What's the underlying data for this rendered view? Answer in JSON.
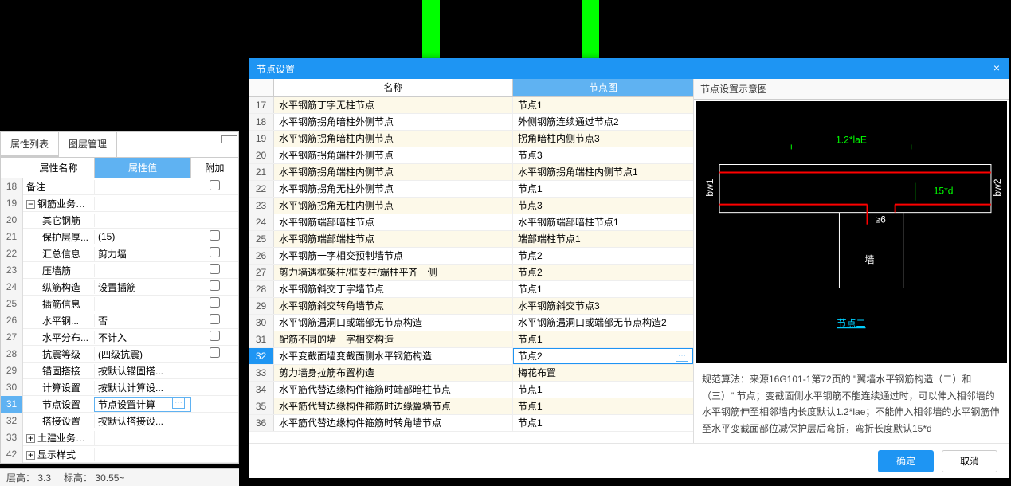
{
  "left": {
    "tab_props": "属性列表",
    "tab_layers": "图层管理",
    "hdr_name": "属性名称",
    "hdr_val": "属性值",
    "hdr_extra": "附加",
    "rows": [
      {
        "n": "18",
        "name": "备注",
        "val": "",
        "chk": true
      },
      {
        "n": "19",
        "name": "钢筋业务属性",
        "val": "",
        "group": true,
        "exp": "−"
      },
      {
        "n": "20",
        "name": "其它钢筋",
        "val": "",
        "indent": 2
      },
      {
        "n": "21",
        "name": "保护层厚...",
        "val": "(15)",
        "chk": true,
        "indent": 2
      },
      {
        "n": "22",
        "name": "汇总信息",
        "val": "剪力墙",
        "chk": true,
        "indent": 2
      },
      {
        "n": "23",
        "name": "压墙筋",
        "val": "",
        "chk": true,
        "indent": 2
      },
      {
        "n": "24",
        "name": "纵筋构造",
        "val": "设置插筋",
        "chk": true,
        "indent": 2
      },
      {
        "n": "25",
        "name": "插筋信息",
        "val": "",
        "chk": true,
        "indent": 2
      },
      {
        "n": "26",
        "name": "水平钢...",
        "val": "否",
        "chk": true,
        "indent": 2
      },
      {
        "n": "27",
        "name": "水平分布...",
        "val": "不计入",
        "chk": true,
        "indent": 2
      },
      {
        "n": "28",
        "name": "抗震等级",
        "val": "(四级抗震)",
        "chk": true,
        "indent": 2
      },
      {
        "n": "29",
        "name": "锚固搭接",
        "val": "按默认锚固搭...",
        "indent": 2
      },
      {
        "n": "30",
        "name": "计算设置",
        "val": "按默认计算设...",
        "indent": 2
      },
      {
        "n": "31",
        "name": "节点设置",
        "val": "节点设置计算",
        "indent": 2,
        "sel": true,
        "more": true
      },
      {
        "n": "32",
        "name": "搭接设置",
        "val": "按默认搭接设...",
        "indent": 2
      },
      {
        "n": "33",
        "name": "土建业务属性",
        "val": "",
        "group": true,
        "exp": "+"
      },
      {
        "n": "42",
        "name": "显示样式",
        "val": "",
        "group": true,
        "exp": "+"
      }
    ]
  },
  "status": {
    "floor_h_label": "层高：",
    "floor_h": "3.3",
    "elev_label": "标高：",
    "elev": "30.55~"
  },
  "dialog": {
    "title": "节点设置",
    "hdr_name": "名称",
    "hdr_img": "节点图",
    "rows": [
      {
        "n": "17",
        "name": "水平钢筋丁字无柱节点",
        "val": "节点1",
        "odd": true
      },
      {
        "n": "18",
        "name": "水平钢筋拐角暗柱外侧节点",
        "val": "外侧钢筋连续通过节点2"
      },
      {
        "n": "19",
        "name": "水平钢筋拐角暗柱内侧节点",
        "val": "拐角暗柱内侧节点3",
        "odd": true
      },
      {
        "n": "20",
        "name": "水平钢筋拐角端柱外侧节点",
        "val": "节点3"
      },
      {
        "n": "21",
        "name": "水平钢筋拐角端柱内侧节点",
        "val": "水平钢筋拐角端柱内侧节点1",
        "odd": true
      },
      {
        "n": "22",
        "name": "水平钢筋拐角无柱外侧节点",
        "val": "节点1"
      },
      {
        "n": "23",
        "name": "水平钢筋拐角无柱内侧节点",
        "val": "节点3",
        "odd": true
      },
      {
        "n": "24",
        "name": "水平钢筋端部暗柱节点",
        "val": "水平钢筋端部暗柱节点1"
      },
      {
        "n": "25",
        "name": "水平钢筋端部端柱节点",
        "val": "端部端柱节点1",
        "odd": true
      },
      {
        "n": "26",
        "name": "水平钢筋一字相交预制墙节点",
        "val": "节点2"
      },
      {
        "n": "27",
        "name": "剪力墙遇框架柱/框支柱/端柱平齐一侧",
        "val": "节点2",
        "odd": true
      },
      {
        "n": "28",
        "name": "水平钢筋斜交丁字墙节点",
        "val": "节点1"
      },
      {
        "n": "29",
        "name": "水平钢筋斜交转角墙节点",
        "val": "水平钢筋斜交节点3",
        "odd": true
      },
      {
        "n": "30",
        "name": "水平钢筋遇洞口或端部无节点构造",
        "val": "水平钢筋遇洞口或端部无节点构造2"
      },
      {
        "n": "31",
        "name": "配筋不同的墙一字相交构造",
        "val": "节点1",
        "odd": true
      },
      {
        "n": "32",
        "name": "水平变截面墙变截面侧水平钢筋构造",
        "val": "节点2",
        "sel": true,
        "more": true
      },
      {
        "n": "33",
        "name": "剪力墙身拉筋布置构造",
        "val": "梅花布置",
        "odd": true
      },
      {
        "n": "34",
        "name": "水平筋代替边缘构件箍筋时端部暗柱节点",
        "val": "节点1"
      },
      {
        "n": "35",
        "name": "水平筋代替边缘构件箍筋时边缘翼墙节点",
        "val": "节点1",
        "odd": true
      },
      {
        "n": "36",
        "name": "水平筋代替边缘构件箍筋时转角墙节点",
        "val": "节点1"
      }
    ],
    "ok": "确定",
    "cancel": "取消"
  },
  "info": {
    "title": "节点设置示意图",
    "dLabel": "节点二",
    "dim1": "1.2*laE",
    "dim2": "15*d",
    "bw1": "bw1",
    "bw2": "bw2",
    "ge6": "≥6",
    "wall": "墙",
    "text": "规范算法：来源16G101-1第72页的 \"翼墙水平钢筋构造（二）和（三）\" 节点；变截面侧水平钢筋不能连续通过时，可以伸入相邻墙的水平钢筋伸至相邻墙内长度默认1.2*lae；不能伸入相邻墙的水平钢筋伸至水平变截面部位减保护层后弯折，弯折长度默认15*d"
  }
}
